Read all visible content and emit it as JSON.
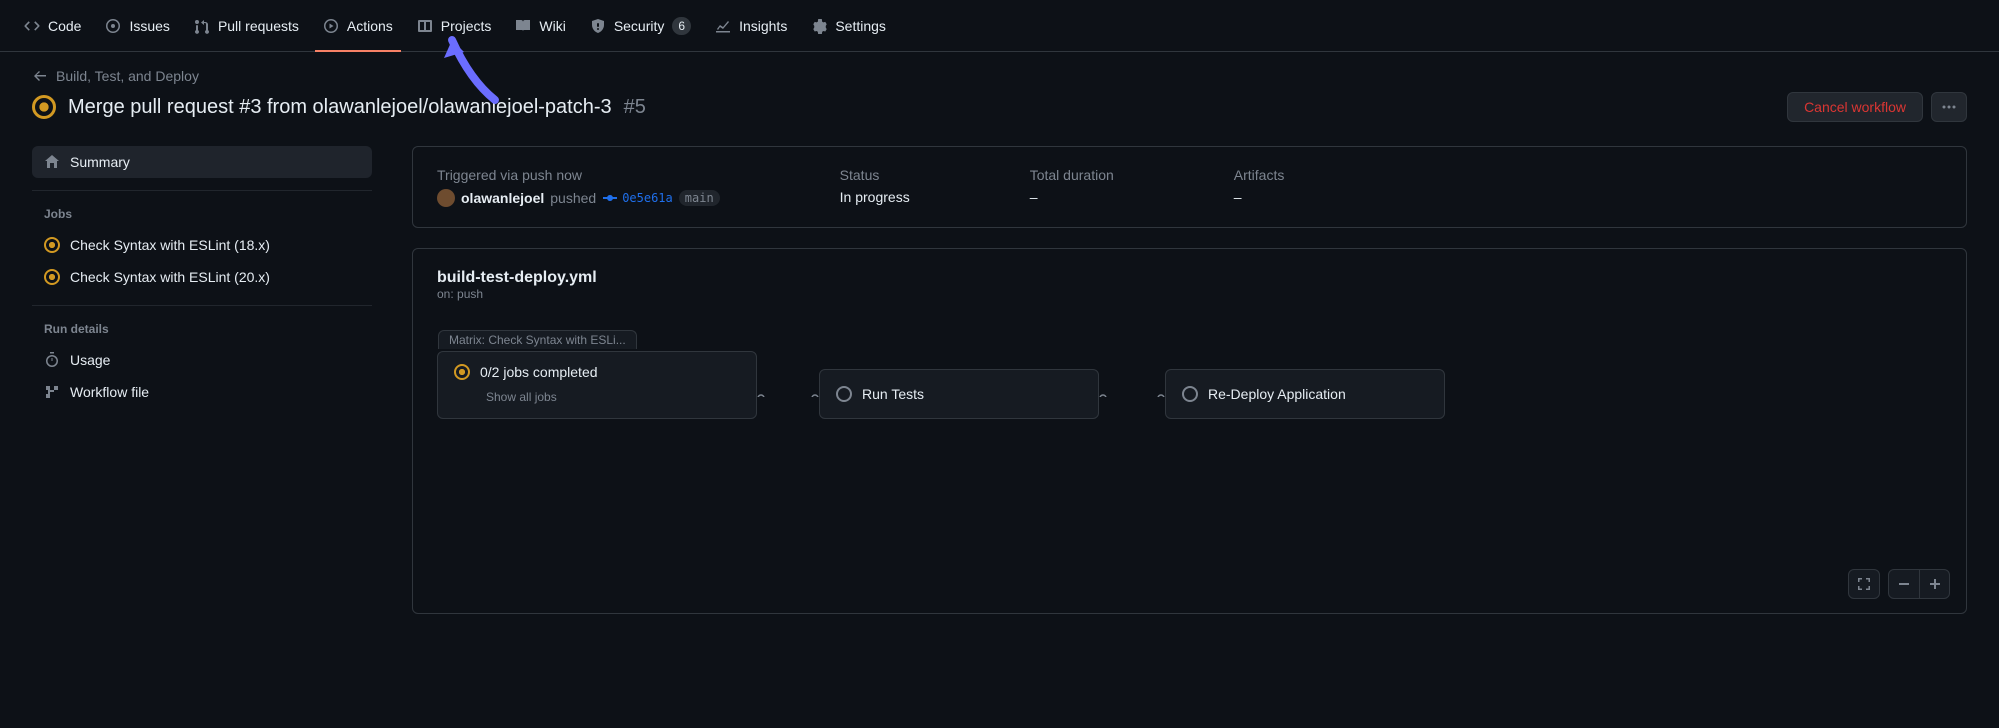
{
  "nav": {
    "code": "Code",
    "issues": "Issues",
    "pulls": "Pull requests",
    "actions": "Actions",
    "projects": "Projects",
    "wiki": "Wiki",
    "security": "Security",
    "security_count": "6",
    "insights": "Insights",
    "settings": "Settings"
  },
  "breadcrumb": {
    "back": "Build, Test, and Deploy"
  },
  "title": {
    "text": "Merge pull request #3 from olawanlejoel/olawanlejoel-patch-3",
    "number": "#5"
  },
  "actions": {
    "cancel": "Cancel workflow"
  },
  "sidebar": {
    "summary": "Summary",
    "jobs_heading": "Jobs",
    "jobs": [
      {
        "label": "Check Syntax with ESLint (18.x)"
      },
      {
        "label": "Check Syntax with ESLint (20.x)"
      }
    ],
    "run_details_heading": "Run details",
    "usage": "Usage",
    "workflow_file": "Workflow file"
  },
  "info": {
    "trigger_label": "Triggered via push now",
    "user": "olawanlejoel",
    "pushed_word": "pushed",
    "commit": "0e5e61a",
    "branch": "main",
    "status_label": "Status",
    "status_value": "In progress",
    "duration_label": "Total duration",
    "duration_value": "–",
    "artifacts_label": "Artifacts",
    "artifacts_value": "–"
  },
  "graph": {
    "wf_name": "build-test-deploy.yml",
    "wf_trigger": "on: push",
    "matrix_tab": "Matrix: Check Syntax with ESLi...",
    "matrix_status": "0/2 jobs completed",
    "matrix_show": "Show all jobs",
    "job_run_tests": "Run Tests",
    "job_redeploy": "Re-Deploy Application"
  }
}
